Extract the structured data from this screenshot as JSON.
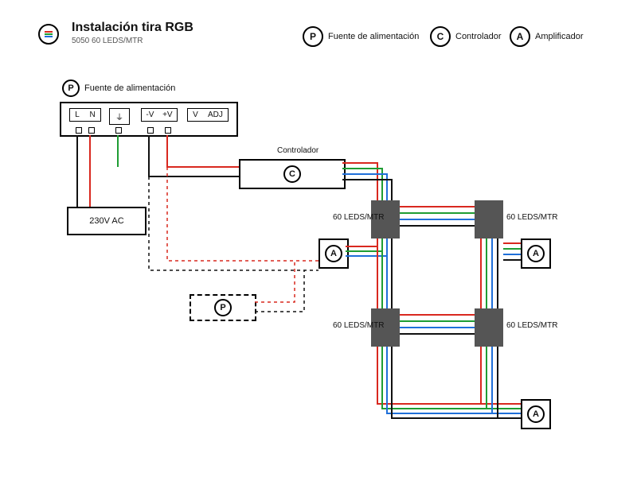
{
  "title": "Instalación tira RGB",
  "subtitle": "5050 60 LEDS/MTR",
  "legend": {
    "P": "Fuente de alimentación",
    "C": "Controlador",
    "A": "Amplificador"
  },
  "psu": {
    "label": "Fuente de alimentación",
    "terms": {
      "L": "L",
      "N": "N",
      "gnd": "⏚",
      "minusV": "-V",
      "plusV": "+V",
      "Vout": "V",
      "ADJ": "ADJ"
    }
  },
  "controller": {
    "label": "Controlador"
  },
  "led_label": "60 LEDS/MTR",
  "ac": "230V AC",
  "symbols": {
    "P": "P",
    "C": "C",
    "A": "A"
  },
  "colors": {
    "red": "#d9281f",
    "green": "#1f9d33",
    "blue": "#1f6fd9",
    "black": "#111"
  }
}
